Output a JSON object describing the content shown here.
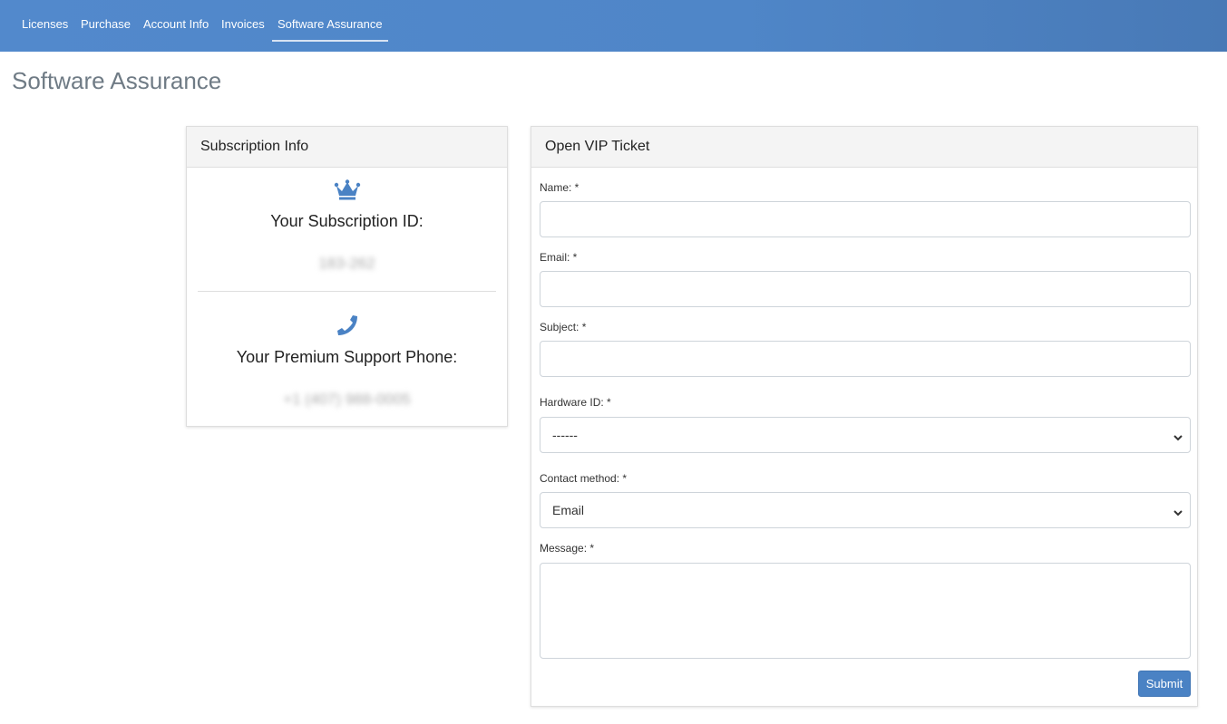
{
  "nav": {
    "items": [
      {
        "label": "Licenses"
      },
      {
        "label": "Purchase"
      },
      {
        "label": "Account Info"
      },
      {
        "label": "Invoices"
      },
      {
        "label": "Software Assurance",
        "active": true
      }
    ]
  },
  "page": {
    "title": "Software Assurance"
  },
  "subscription": {
    "header": "Subscription Info",
    "id_icon": "crown-icon",
    "id_label": "Your Subscription ID:",
    "id_value": "183-262",
    "phone_icon": "phone-icon",
    "phone_label": "Your Premium Support Phone:",
    "phone_value": "+1 (407) 988-0005"
  },
  "ticket": {
    "header": "Open VIP Ticket",
    "name_label": "Name: *",
    "name_value": "",
    "email_label": "Email: *",
    "email_value": "",
    "subject_label": "Subject: *",
    "subject_value": "",
    "hardware_label": "Hardware ID: *",
    "hardware_selected": "------",
    "contact_label": "Contact method: *",
    "contact_selected": "Email",
    "message_label": "Message: *",
    "message_value": "",
    "submit_label": "Submit"
  },
  "colors": {
    "nav_bg": "#4f86c8",
    "accent": "#4a82c4",
    "title": "#6f7b85"
  }
}
